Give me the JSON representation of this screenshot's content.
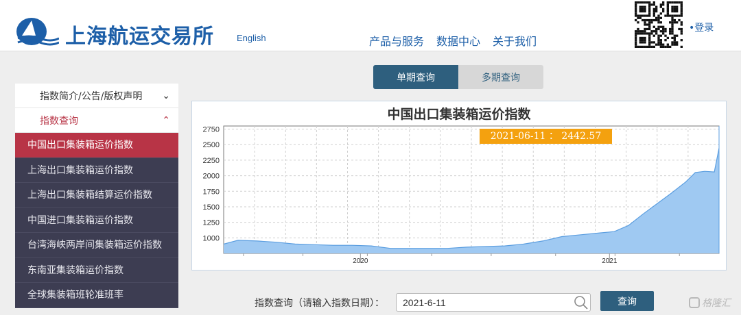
{
  "header": {
    "brand": "上海航运交易所",
    "english_link": "English",
    "nav": [
      "产品与服务",
      "数据中心",
      "关于我们"
    ],
    "login": "•登录"
  },
  "sidebar": {
    "groups": [
      {
        "label": "指数简介/公告/版权声明",
        "icon": "chevron-down-icon"
      },
      {
        "label": "指数查询",
        "icon": "chevron-up-icon"
      }
    ],
    "items": [
      "中国出口集装箱运价指数",
      "上海出口集装箱运价指数",
      "上海出口集装箱结算运价指数",
      "中国进口集装箱运价指数",
      "台湾海峡两岸间集装箱运价指数",
      "东南亚集装箱运价指数",
      "全球集装箱班轮准班率"
    ]
  },
  "tabs": [
    "单期查询",
    "多期查询"
  ],
  "tooltip": "2021-06-11 ： 2442.57",
  "query": {
    "label": "指数查询（请输入指数日期）：",
    "value": "2021-6-11",
    "button": "查询"
  },
  "watermark": "格隆汇",
  "colors": {
    "accent": "#2e5f7e",
    "active_red": "#b83446",
    "sidebar_bg": "#3d3d52",
    "area_fill": "#9fc9f2",
    "tooltip": "#f4a10f"
  },
  "chart_data": {
    "type": "area",
    "title": "中国出口集装箱运价指数",
    "x_tick_labels": [
      "2020",
      "2021"
    ],
    "y_ticks": [
      1000,
      1250,
      1500,
      1750,
      2000,
      2250,
      2500,
      2750
    ],
    "ylim": [
      750,
      2800
    ],
    "series": [
      {
        "values": [
          {
            "x": "2019-06-14",
            "y": 900
          },
          {
            "x": "2019-07-05",
            "y": 960
          },
          {
            "x": "2019-08-02",
            "y": 950
          },
          {
            "x": "2019-08-30",
            "y": 930
          },
          {
            "x": "2019-09-27",
            "y": 900
          },
          {
            "x": "2019-10-25",
            "y": 890
          },
          {
            "x": "2019-11-22",
            "y": 880
          },
          {
            "x": "2019-12-20",
            "y": 880
          },
          {
            "x": "2020-01-17",
            "y": 870
          },
          {
            "x": "2020-02-14",
            "y": 830
          },
          {
            "x": "2020-03-13",
            "y": 830
          },
          {
            "x": "2020-04-10",
            "y": 830
          },
          {
            "x": "2020-05-08",
            "y": 830
          },
          {
            "x": "2020-06-05",
            "y": 850
          },
          {
            "x": "2020-07-03",
            "y": 860
          },
          {
            "x": "2020-07-31",
            "y": 870
          },
          {
            "x": "2020-08-28",
            "y": 900
          },
          {
            "x": "2020-09-25",
            "y": 950
          },
          {
            "x": "2020-10-23",
            "y": 1020
          },
          {
            "x": "2020-11-20",
            "y": 1050
          },
          {
            "x": "2020-12-18",
            "y": 1080
          },
          {
            "x": "2021-01-08",
            "y": 1100
          },
          {
            "x": "2021-01-29",
            "y": 1200
          },
          {
            "x": "2021-02-19",
            "y": 1380
          },
          {
            "x": "2021-03-12",
            "y": 1550
          },
          {
            "x": "2021-04-02",
            "y": 1720
          },
          {
            "x": "2021-04-23",
            "y": 1900
          },
          {
            "x": "2021-05-07",
            "y": 2050
          },
          {
            "x": "2021-05-21",
            "y": 2070
          },
          {
            "x": "2021-06-04",
            "y": 2060
          },
          {
            "x": "2021-06-11",
            "y": 2442.57
          }
        ]
      }
    ]
  }
}
